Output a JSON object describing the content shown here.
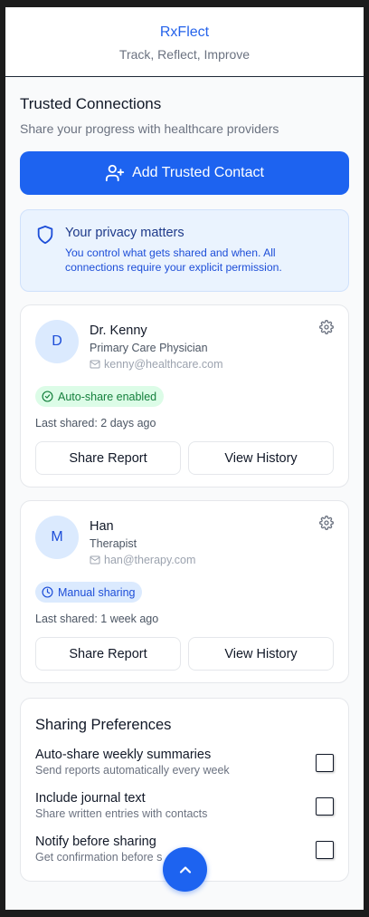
{
  "header": {
    "title": "RxFlect",
    "subtitle": "Track, Reflect, Improve"
  },
  "section": {
    "title": "Trusted Connections",
    "subtitle": "Share your progress with healthcare providers"
  },
  "add_button": {
    "label": "Add Trusted Contact",
    "icon": "user-plus-icon"
  },
  "privacy": {
    "icon": "shield-icon",
    "title": "Your privacy matters",
    "text": "You control what gets shared and when. All connections require your explicit permission."
  },
  "contacts": [
    {
      "initial": "D",
      "name": "Dr. Kenny",
      "role": "Primary Care Physician",
      "email": "kenny@healthcare.com",
      "badge": "Auto-share enabled",
      "badge_icon": "check-circle-icon",
      "last_shared": "Last shared: 2 days ago",
      "share_label": "Share Report",
      "history_label": "View History"
    },
    {
      "initial": "M",
      "name": "Han",
      "role": "Therapist",
      "email": "han@therapy.com",
      "badge": "Manual sharing",
      "badge_icon": "clock-icon",
      "last_shared": "Last shared: 1 week ago",
      "share_label": "Share Report",
      "history_label": "View History"
    }
  ],
  "preferences": {
    "title": "Sharing Preferences",
    "items": [
      {
        "label": "Auto-share weekly summaries",
        "desc": "Send reports automatically every week",
        "checked": false
      },
      {
        "label": "Include journal text",
        "desc": "Share written entries with contacts",
        "checked": false
      },
      {
        "label": "Notify before sharing",
        "desc": "Get confirmation before s",
        "checked": false
      }
    ]
  },
  "fab": {
    "icon": "chevron-up-icon"
  },
  "colors": {
    "accent": "#1d63f0",
    "success": "#15803d",
    "info_bg": "#eaf3fe"
  }
}
